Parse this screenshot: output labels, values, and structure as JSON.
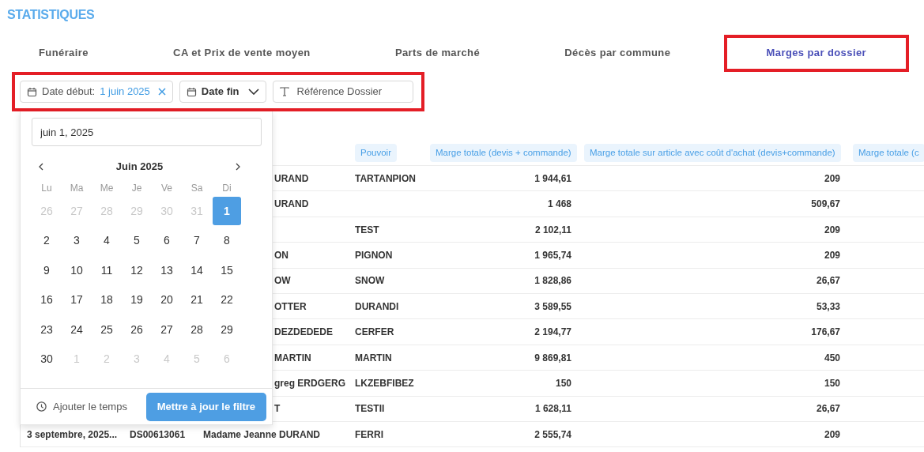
{
  "title": "STATISTIQUES",
  "tabs": [
    {
      "label": "Funéraire",
      "selected": false,
      "highlighted": false
    },
    {
      "label": "CA et Prix de vente moyen",
      "selected": false,
      "highlighted": false
    },
    {
      "label": "Parts de marché",
      "selected": false,
      "highlighted": false
    },
    {
      "label": "Décès par commune",
      "selected": false,
      "highlighted": false
    },
    {
      "label": "Marges par dossier",
      "selected": true,
      "highlighted": true
    }
  ],
  "filters_highlighted": true,
  "filters": [
    {
      "kind": "date",
      "label": "Date début:",
      "value": "1 juin 2025",
      "clearable": true
    },
    {
      "kind": "dropdown",
      "label": "Date fin"
    },
    {
      "kind": "text",
      "label": "Référence Dossier"
    }
  ],
  "table": {
    "columns": [
      "Pouvoir",
      "Marge totale (devis + commande)",
      "Marge totale sur article avec coût d'achat (devis+commande)",
      "Marge totale (c"
    ],
    "rows": [
      {
        "name": "URAND",
        "pouvoir": "TARTANPION",
        "marge_totale": "1 944,61",
        "marge_article": "209"
      },
      {
        "name": "URAND",
        "pouvoir": "",
        "marge_totale": "1 468",
        "marge_article": "509,67"
      },
      {
        "name": "",
        "pouvoir": "TEST",
        "marge_totale": "2 102,11",
        "marge_article": "209"
      },
      {
        "name": "ON",
        "pouvoir": "PIGNON",
        "marge_totale": "1 965,74",
        "marge_article": "209"
      },
      {
        "name": "OW",
        "pouvoir": "SNOW",
        "marge_totale": "1 828,86",
        "marge_article": "26,67"
      },
      {
        "name": "OTTER",
        "pouvoir": "DURANDI",
        "marge_totale": "3 589,55",
        "marge_article": "53,33"
      },
      {
        "name": "DEZDEDEDE",
        "pouvoir": "CERFER",
        "marge_totale": "2 194,77",
        "marge_article": "176,67"
      },
      {
        "name": "MARTIN",
        "pouvoir": "MARTIN",
        "marge_totale": "9 869,81",
        "marge_article": "450"
      },
      {
        "name": "greg ERDGERG",
        "pouvoir": "LKZEBFIBEZ",
        "marge_totale": "150",
        "marge_article": "150"
      },
      {
        "name": "T",
        "pouvoir": "TESTII",
        "marge_totale": "1 628,11",
        "marge_article": "26,67"
      },
      {
        "date": "3 septembre, 2025...",
        "reference": "DS00613061",
        "name": "Madame Jeanne DURAND",
        "pouvoir": "FERRI",
        "marge_totale": "2 555,74",
        "marge_article": "209"
      }
    ]
  },
  "date_picker": {
    "input_value": "juin 1, 2025",
    "month": "Juin 2025",
    "weekdays": [
      "Lu",
      "Ma",
      "Me",
      "Je",
      "Ve",
      "Sa",
      "Di"
    ],
    "days": [
      {
        "label": "26",
        "outside": true,
        "selected": false
      },
      {
        "label": "27",
        "outside": true,
        "selected": false
      },
      {
        "label": "28",
        "outside": true,
        "selected": false
      },
      {
        "label": "29",
        "outside": true,
        "selected": false
      },
      {
        "label": "30",
        "outside": true,
        "selected": false
      },
      {
        "label": "31",
        "outside": true,
        "selected": false
      },
      {
        "label": "1",
        "outside": false,
        "selected": true
      },
      {
        "label": "2",
        "outside": false,
        "selected": false
      },
      {
        "label": "3",
        "outside": false,
        "selected": false
      },
      {
        "label": "4",
        "outside": false,
        "selected": false
      },
      {
        "label": "5",
        "outside": false,
        "selected": false
      },
      {
        "label": "6",
        "outside": false,
        "selected": false
      },
      {
        "label": "7",
        "outside": false,
        "selected": false
      },
      {
        "label": "8",
        "outside": false,
        "selected": false
      },
      {
        "label": "9",
        "outside": false,
        "selected": false
      },
      {
        "label": "10",
        "outside": false,
        "selected": false
      },
      {
        "label": "11",
        "outside": false,
        "selected": false
      },
      {
        "label": "12",
        "outside": false,
        "selected": false
      },
      {
        "label": "13",
        "outside": false,
        "selected": false
      },
      {
        "label": "14",
        "outside": false,
        "selected": false
      },
      {
        "label": "15",
        "outside": false,
        "selected": false
      },
      {
        "label": "16",
        "outside": false,
        "selected": false
      },
      {
        "label": "17",
        "outside": false,
        "selected": false
      },
      {
        "label": "18",
        "outside": false,
        "selected": false
      },
      {
        "label": "19",
        "outside": false,
        "selected": false
      },
      {
        "label": "20",
        "outside": false,
        "selected": false
      },
      {
        "label": "21",
        "outside": false,
        "selected": false
      },
      {
        "label": "22",
        "outside": false,
        "selected": false
      },
      {
        "label": "23",
        "outside": false,
        "selected": false
      },
      {
        "label": "24",
        "outside": false,
        "selected": false
      },
      {
        "label": "25",
        "outside": false,
        "selected": false
      },
      {
        "label": "26",
        "outside": false,
        "selected": false
      },
      {
        "label": "27",
        "outside": false,
        "selected": false
      },
      {
        "label": "28",
        "outside": false,
        "selected": false
      },
      {
        "label": "29",
        "outside": false,
        "selected": false
      },
      {
        "label": "30",
        "outside": false,
        "selected": false
      },
      {
        "label": "1",
        "outside": true,
        "selected": false
      },
      {
        "label": "2",
        "outside": true,
        "selected": false
      },
      {
        "label": "3",
        "outside": true,
        "selected": false
      },
      {
        "label": "4",
        "outside": true,
        "selected": false
      },
      {
        "label": "5",
        "outside": true,
        "selected": false
      },
      {
        "label": "6",
        "outside": true,
        "selected": false
      }
    ],
    "add_time": "Ajouter le temps",
    "apply": "Mettre à jour le filtre"
  }
}
